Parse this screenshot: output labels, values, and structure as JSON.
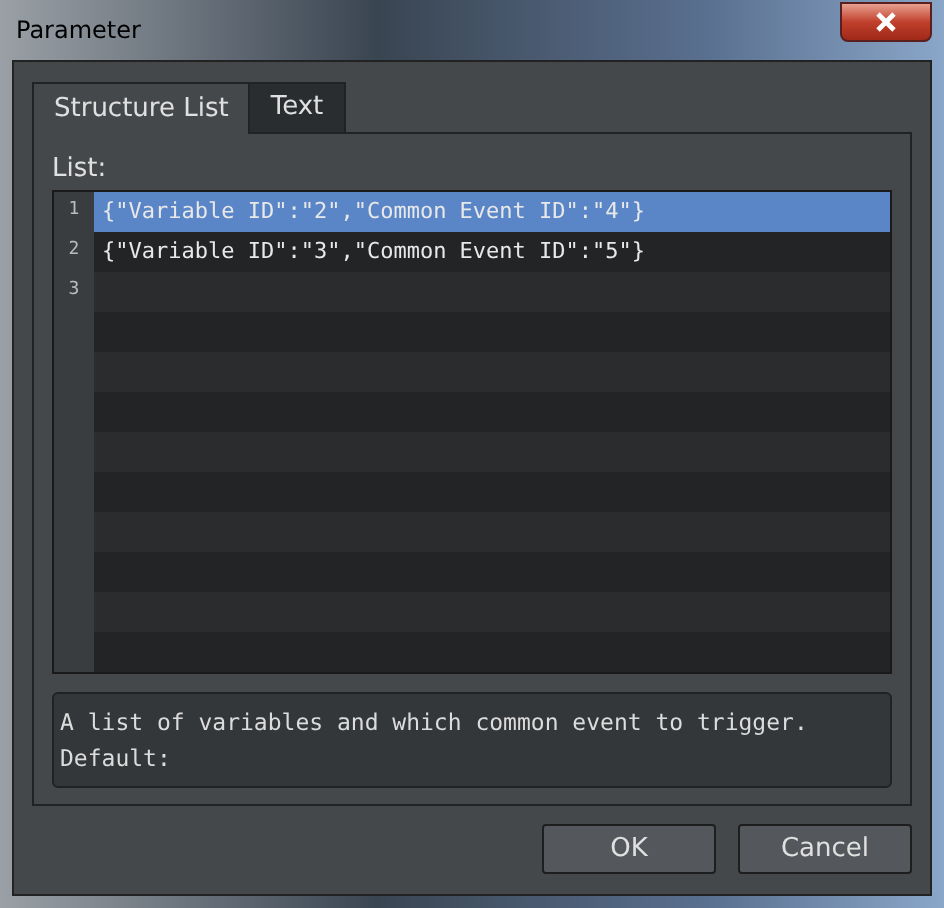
{
  "window": {
    "title": "Parameter"
  },
  "tabs": [
    {
      "label": "Structure List",
      "selected": true
    },
    {
      "label": "Text",
      "selected": false
    }
  ],
  "list": {
    "label": "List:",
    "rows": [
      {
        "number": "1",
        "text": "{\"Variable ID\":\"2\",\"Common Event ID\":\"4\"}",
        "selected": true
      },
      {
        "number": "2",
        "text": "{\"Variable ID\":\"3\",\"Common Event ID\":\"5\"}",
        "selected": false
      },
      {
        "number": "3",
        "selected": false
      }
    ]
  },
  "description": [
    "A list of variables and which common event to trigger.",
    "Default:"
  ],
  "buttons": [
    "OK",
    "Cancel"
  ]
}
